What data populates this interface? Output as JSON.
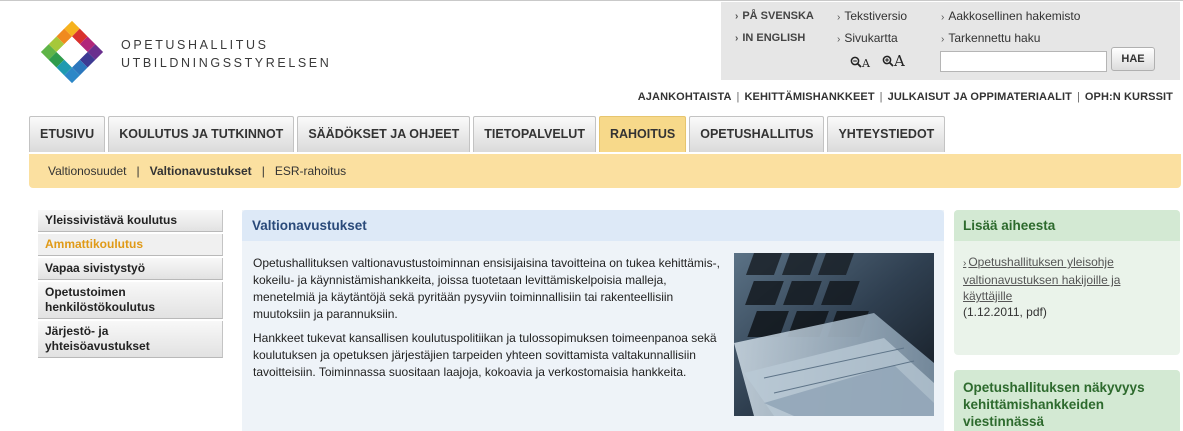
{
  "org": {
    "name_fi": "OPETUSHALLITUS",
    "name_sv": "UTBILDNINGSSTYRELSEN"
  },
  "tools": {
    "lang_sv": "PÅ SVENSKA",
    "lang_en": "IN ENGLISH",
    "text_version": "Tekstiversio",
    "sitemap": "Sivukartta",
    "az_index": "Aakkosellinen hakemisto",
    "advanced_search": "Tarkennettu haku",
    "zoom_out_label": "A",
    "zoom_in_label": "A",
    "search_button": "HAE",
    "search_value": ""
  },
  "secondary_nav": [
    "AJANKOHTAISTA",
    "KEHITTÄMISHANKKEET",
    "JULKAISUT JA OPPIMATERIAALIT",
    "OPH:N KURSSIT"
  ],
  "tabs": [
    {
      "label": "ETUSIVU",
      "active": false
    },
    {
      "label": "KOULUTUS JA TUTKINNOT",
      "active": false
    },
    {
      "label": "SÄÄDÖKSET JA OHJEET",
      "active": false
    },
    {
      "label": "TIETOPALVELUT",
      "active": false
    },
    {
      "label": "RAHOITUS",
      "active": true
    },
    {
      "label": "OPETUSHALLITUS",
      "active": false
    },
    {
      "label": "YHTEYSTIEDOT",
      "active": false
    }
  ],
  "subnav": [
    {
      "label": "Valtionosuudet",
      "current": false
    },
    {
      "label": "Valtionavustukset",
      "current": true
    },
    {
      "label": "ESR-rahoitus",
      "current": false
    }
  ],
  "leftnav": [
    {
      "label": "Yleissivistävä koulutus",
      "active": false
    },
    {
      "label": "Ammattikoulutus",
      "active": true
    },
    {
      "label": "Vapaa sivistystyö",
      "active": false
    },
    {
      "label": "Opetustoimen henkilöstökoulutus",
      "active": false
    },
    {
      "label": "Järjestö- ja yhteisöavustukset",
      "active": false
    }
  ],
  "main": {
    "title": "Valtionavustukset",
    "paragraphs": [
      "Opetushallituksen valtionavustustoiminnan ensisijaisina tavoitteina on tukea kehittämis-, kokeilu- ja käynnistämishankkeita, joissa tuotetaan levittämiskelpoisia malleja, menetelmiä ja käytäntöjä sekä pyritään pysyviin toiminnallisiin tai rakenteellisiin muutoksiin ja parannuksiin.",
      "Hankkeet tukevat kansallisen koulutuspolitiikan ja tulossopimuksen toimeenpanoa sekä koulutuksen ja opetuksen järjestäjien tarpeiden yhteen sovittamista valtakunnallisiin tavoitteisiin. Toiminnassa suositaan laajoja, kokoavia ja verkostomaisia hankkeita."
    ]
  },
  "side": {
    "box1_title": "Lisää aiheesta",
    "box1_link": "Opetushallituksen yleisohje valtionavustuksen hakijoille ja käyttäjille",
    "box1_meta": "(1.12.2011, pdf)",
    "box2_title": "Opetushallituksen näkyvyys kehittämishankkeiden viestinnässä"
  },
  "colors": {
    "active_tab": "#f7d98a",
    "subbar": "#fbe0a0",
    "active_left": "#e09a17",
    "main_head": "#dde9f7",
    "main_title": "#2a4a7a",
    "side_head": "#d3e9d3",
    "side_title": "#2d6a2d"
  }
}
